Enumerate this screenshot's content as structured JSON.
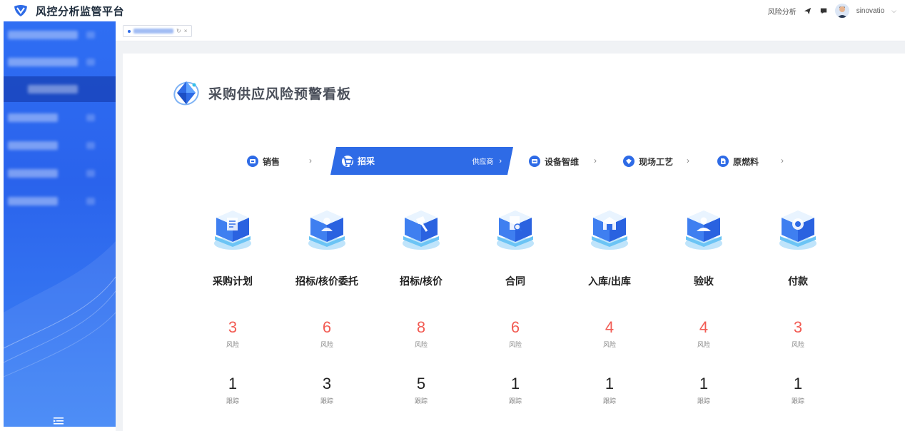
{
  "header": {
    "app_title": "风控分析监管平台",
    "nav_label": "风险分析",
    "username": "sinovatio"
  },
  "icons": {
    "logo": "shield-logo-icon",
    "send": "paper-plane-icon",
    "message": "message-icon",
    "collapse": "menu-fold-icon"
  },
  "colors": {
    "accent": "#2e6be6",
    "sidebar": "#2f6ef3",
    "risk": "#f25c54"
  },
  "page": {
    "title": "采购供应风险预警看板"
  },
  "stages": [
    {
      "label": "销售",
      "icon": "sales-icon"
    },
    {
      "label": "招采",
      "icon": "cart-icon",
      "sub_label": "供应商",
      "active": true
    },
    {
      "label": "设备智维",
      "icon": "device-icon"
    },
    {
      "label": "现场工艺",
      "icon": "craft-icon"
    },
    {
      "label": "原燃料",
      "icon": "fuel-icon"
    }
  ],
  "process": [
    {
      "name": "采购计划",
      "risk": "3",
      "track": "1",
      "icon": "plan-icon"
    },
    {
      "name": "招标/核价委托",
      "risk": "6",
      "track": "3",
      "icon": "entrust-icon"
    },
    {
      "name": "招标/核价",
      "risk": "8",
      "track": "5",
      "icon": "bid-icon"
    },
    {
      "name": "合同",
      "risk": "6",
      "track": "1",
      "icon": "contract-icon"
    },
    {
      "name": "入库/出库",
      "risk": "4",
      "track": "1",
      "icon": "warehouse-icon"
    },
    {
      "name": "验收",
      "risk": "4",
      "track": "1",
      "icon": "acceptance-icon"
    },
    {
      "name": "付款",
      "risk": "3",
      "track": "1",
      "icon": "payment-icon"
    }
  ],
  "labels": {
    "risk": "风险",
    "track": "跟踪"
  }
}
